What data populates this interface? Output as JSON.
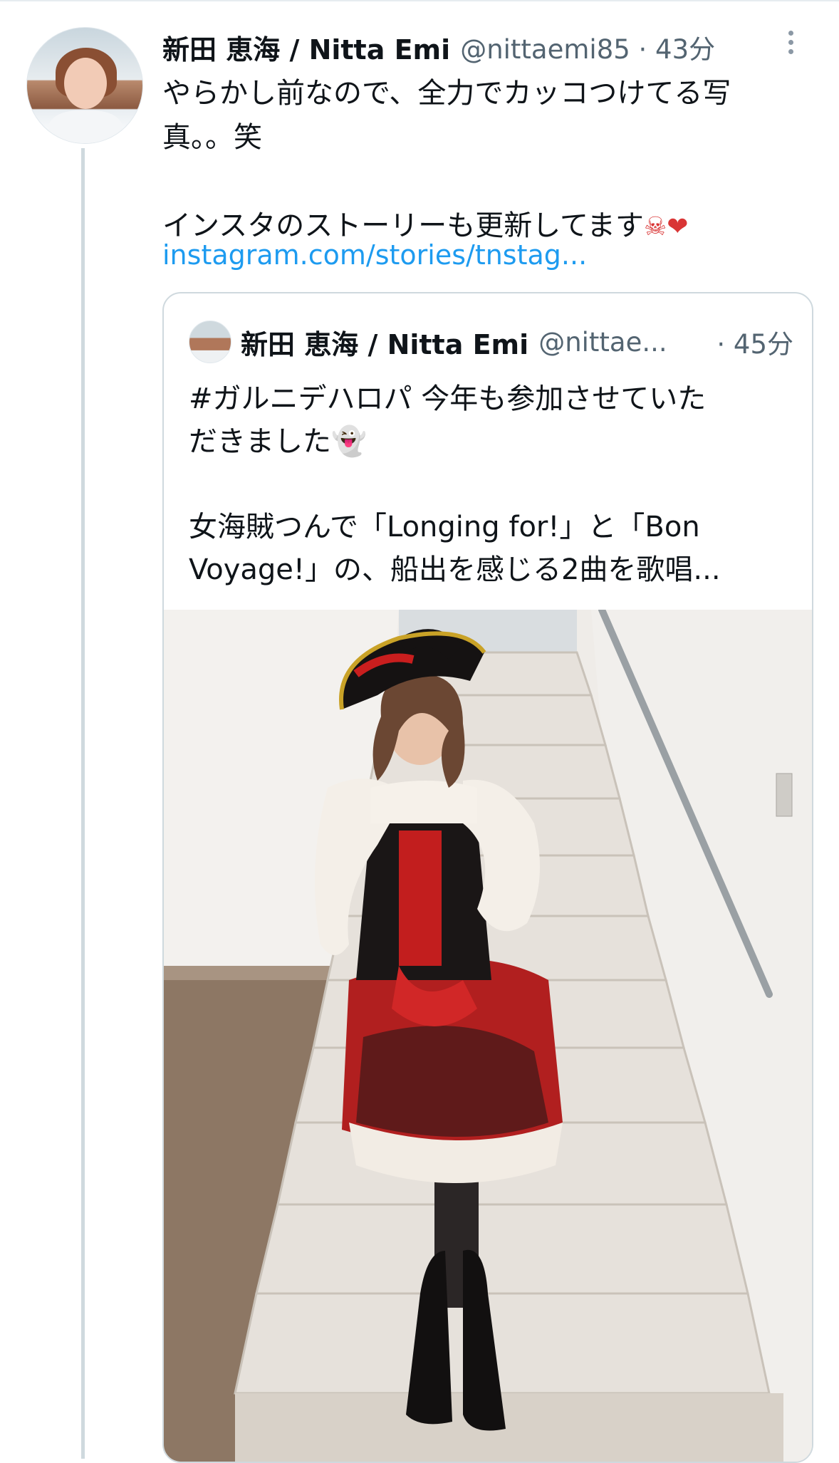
{
  "tweet": {
    "display_name": "新田 恵海 / Nitta Emi",
    "handle_time": "@nittaemi85 · 43分",
    "text_line1": "やらかし前なので、全力でカッコつけてる写",
    "text_line2": "真。。笑",
    "text_line3": "インスタのストーリーも更新してます",
    "emojis": "☠❤",
    "link": "instagram.com/stories/tnstag..."
  },
  "quote": {
    "display_name": "新田 恵海 / Nitta Emi",
    "handle": "@nittae...",
    "time": "· 45分",
    "text": "#ガルニデハロパ 今年も参加させていた\nだきました👻\n\n女海賊つんで「Longing for!」と「Bon\nVoyage!」の、船出を感じる2曲を歌唱..."
  },
  "colors": {
    "link": "#1d9bf0",
    "secondary_text": "#536471",
    "border": "#cfd9de"
  },
  "icons": [
    "more-options-icon",
    "skull-crossbones-icon",
    "red-heart-icon",
    "ghost-icon"
  ]
}
